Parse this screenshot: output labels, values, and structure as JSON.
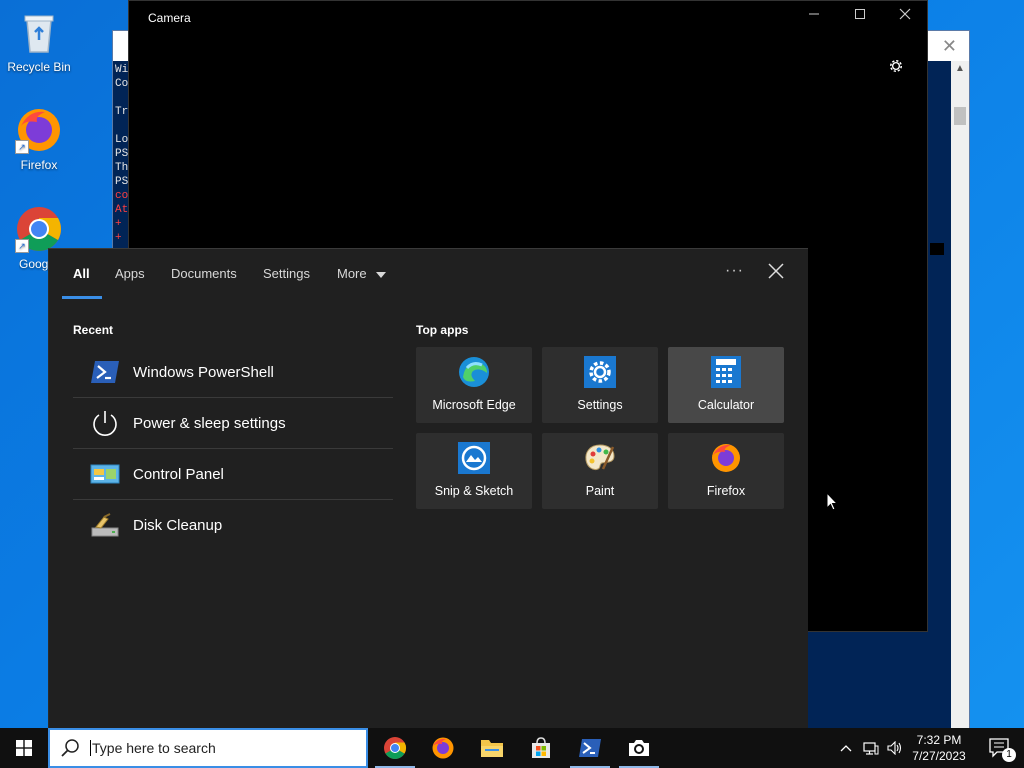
{
  "desktop": {
    "icons": [
      {
        "label": "Recycle Bin"
      },
      {
        "label": "Firefox"
      },
      {
        "label": "Google Chrome"
      }
    ]
  },
  "powershell": {
    "lines": [
      "Wi",
      "Co",
      "",
      "Tr",
      "",
      "Lo",
      "PS",
      "Th",
      "PS",
      "co",
      "At",
      "+",
      "+"
    ]
  },
  "camera": {
    "title": "Camera"
  },
  "search_panel": {
    "tabs": [
      {
        "label": "All"
      },
      {
        "label": "Apps"
      },
      {
        "label": "Documents"
      },
      {
        "label": "Settings"
      },
      {
        "label": "More"
      }
    ],
    "dots": "···",
    "recent_title": "Recent",
    "recent": [
      {
        "label": "Windows PowerShell"
      },
      {
        "label": "Power & sleep settings"
      },
      {
        "label": "Control Panel"
      },
      {
        "label": "Disk Cleanup"
      }
    ],
    "top_apps_title": "Top apps",
    "top_apps": [
      {
        "label": "Microsoft Edge"
      },
      {
        "label": "Settings"
      },
      {
        "label": "Calculator"
      },
      {
        "label": "Snip & Sketch"
      },
      {
        "label": "Paint"
      },
      {
        "label": "Firefox"
      }
    ]
  },
  "taskbar": {
    "search_placeholder": "Type here to search",
    "time": "7:32 PM",
    "date": "7/27/2023",
    "notification_count": "1"
  },
  "colors": {
    "accent": "#3a8ee6",
    "panel_bg": "#202020",
    "tile_bg": "#2e2e2e",
    "taskbar_bg": "#101010"
  }
}
